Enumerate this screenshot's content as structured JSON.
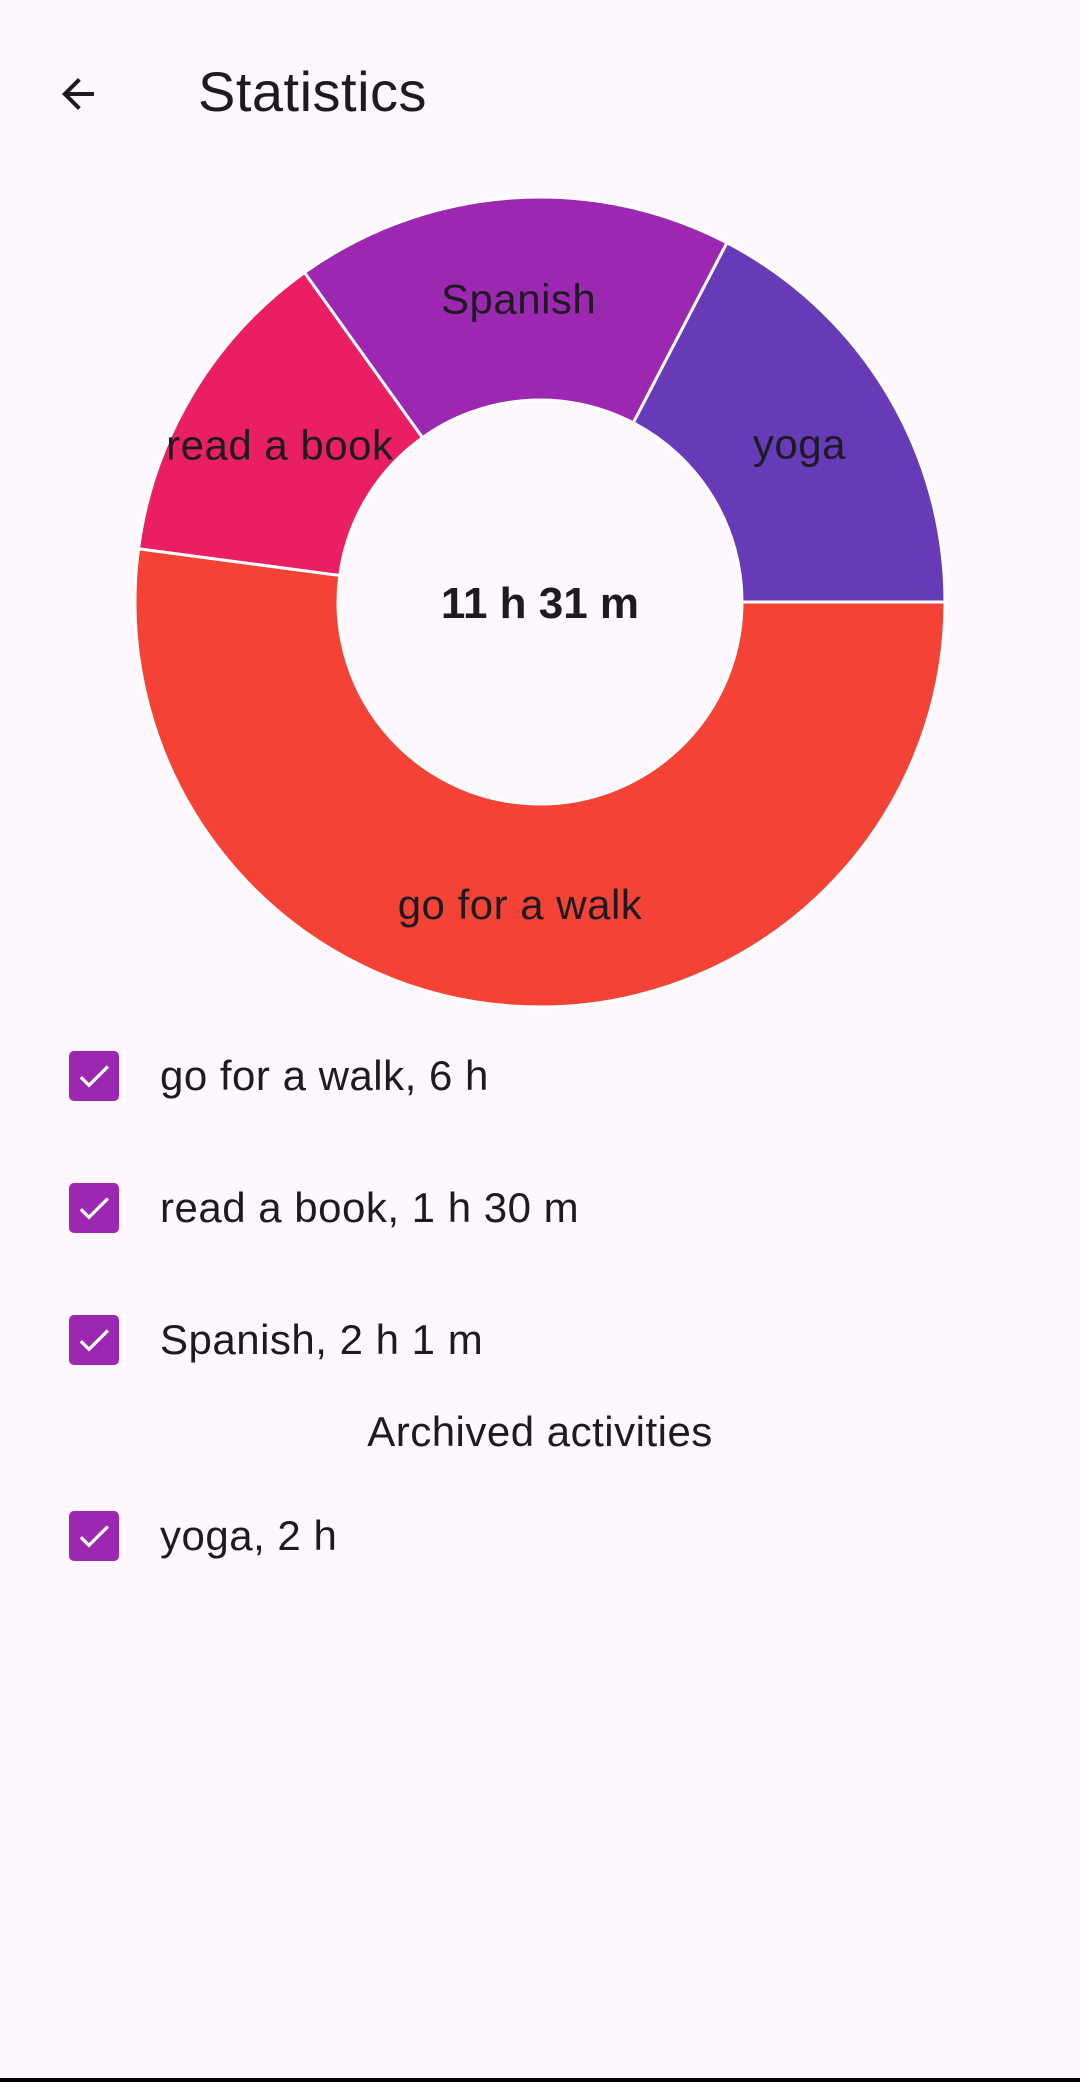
{
  "app_bar": {
    "title": "Statistics",
    "back_icon": "arrow-back-icon"
  },
  "chart_data": {
    "type": "pie",
    "donut": true,
    "center_label": "11 h 31 m",
    "slices": [
      {
        "label": "yoga",
        "minutes": 120,
        "color": "#673ab7"
      },
      {
        "label": "go for a walk",
        "minutes": 360,
        "color": "#f44336"
      },
      {
        "label": "read a book",
        "minutes": 90,
        "color": "#e91e63"
      },
      {
        "label": "Spanish",
        "minutes": 121,
        "color": "#9c27b0"
      }
    ]
  },
  "activities": [
    {
      "label": "go for a walk, 6 h",
      "checked": true
    },
    {
      "label": "read a book, 1 h 30 m",
      "checked": true
    },
    {
      "label": "Spanish, 2 h 1 m",
      "checked": true
    }
  ],
  "archived": {
    "header": "Archived activities",
    "items": [
      {
        "label": "yoga, 2 h",
        "checked": true
      }
    ]
  },
  "colors": {
    "background": "#fef7fd",
    "checkbox": "#9c27b0",
    "text": "#1d1b20"
  }
}
